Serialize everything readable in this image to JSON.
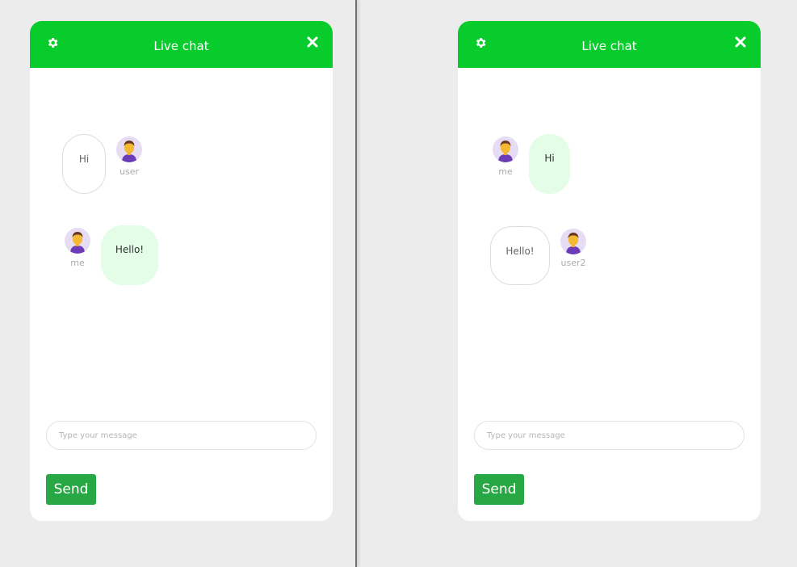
{
  "left_chat": {
    "title": "Live chat",
    "messages": [
      {
        "sender": "user",
        "text": "Hi"
      },
      {
        "sender": "me",
        "text": "Hello!"
      }
    ],
    "input_placeholder": "Type your message",
    "send_label": "Send"
  },
  "right_chat": {
    "title": "Live chat",
    "messages": [
      {
        "sender": "me",
        "text": "Hi"
      },
      {
        "sender": "user2",
        "text": "Hello!"
      }
    ],
    "input_placeholder": "Type your message",
    "send_label": "Send"
  },
  "icons": {
    "settings": "gear-icon",
    "close": "close-icon",
    "avatar": "person-avatar-icon"
  },
  "colors": {
    "header": "#08cb2c",
    "send_button": "#27a844",
    "my_bubble": "#e3fde6",
    "other_bubble_border": "#dcdcdc",
    "avatar_bg": "#e6dcf3"
  }
}
